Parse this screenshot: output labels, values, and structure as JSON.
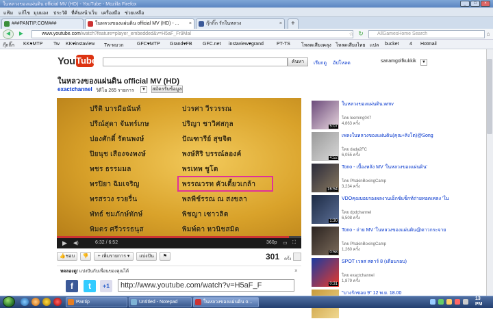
{
  "window": {
    "title": "ในหลวงของแผ่นดิน official MV (HD) - YouTube - Mozilla Firefox"
  },
  "menu": [
    "แฟ้ม",
    "แก้ไข",
    "มุมมอง",
    "ประวัติ",
    "ที่คั่นหน้าเว็บ",
    "เครื่องมือ",
    "ช่วยเหลือ"
  ],
  "tabs": [
    {
      "label": "###PANTIP.COM###",
      "fav": "#3a8f3a"
    },
    {
      "label": "ในหลวงของแผ่นดิน official MV (HD) - ...",
      "fav": "#c33"
    },
    {
      "label": "กุ๊กกิ๊ก รักในหลวง",
      "fav": "#3b5998"
    }
  ],
  "nav": {
    "url_host": "www.youtube.com",
    "url_path": "/watch?feature=player_embedded&v=H5aF_Fr9Mal",
    "search_placeholder": "AllGamesHome Search"
  },
  "bookmarks": [
    "กุ๊กกิ๊ก",
    "KK♥MTP",
    "Tw",
    "KK♥instaview",
    "Tw-หมวก",
    "GFC♥MTP",
    "Grand♥FB",
    "GFC.net",
    "instaview♥grand",
    "PT-TS",
    "โหลดเสียงคลุง",
    "โหลดเสียงไทย",
    "แปล",
    "bucket",
    "4",
    "Hotmail"
  ],
  "youtube": {
    "logo_you": "You",
    "logo_tube": "Tube",
    "search_btn": "ค้นหา",
    "links": [
      "เรียกดู",
      "อัปโหลด"
    ],
    "user": "sanamgolfkukkik"
  },
  "video": {
    "title": "ในหลวงของแผ่นดิน official MV (HD)",
    "channel": "exactchannel",
    "video_count": "วิดีโอ 265 รายการ",
    "subscribe": "สมัครรับข้อมูล",
    "credits_left": [
      "ปรีดิ บารมีอนันท์",
      "ปรีณ์สุดา จันทร์เกษ",
      "ปองศักดิ์ รัตนพงษ์",
      "ปิยนุช เสืองจงพงษ์",
      "พชร ธรรมมล",
      "พรปิยา ฉิมเจริญ",
      "พรสรวง รวยรื่น",
      "พัทธ์ ชมภักษ์ทักษ์",
      "พิมตร ศรีวรรธนุส"
    ],
    "credits_right": [
      "ปวรศา วีรวรรณ",
      "ปริญา ชาวิศสกุล",
      "ปัณฑารีย์ สุขจิต",
      "พงษ์สิริ บรรณ์ลองค์",
      "พรเทพ ชูโต",
      "พรรณวรท คัวเตี้ยวเกล้า",
      "พลพีช์รรณ ณ สงขลา",
      "พิชญา เซาวลิต",
      "พิมพ์ดา หวนิชสมิต"
    ],
    "time": "6:32 / 6:52",
    "quality": "360p",
    "progress": 0.95
  },
  "actions": {
    "like": "ชอบ",
    "add_to": "+ เพิ่มรายการ",
    "share": "แบ่งปัน",
    "views": "301",
    "views_unit": "ครั้ง"
  },
  "share": {
    "title": "ทดลองดู!",
    "text": " แบ่งปันกับเพื่อนของคุณได้",
    "url": "http://www.youtube.com/watch?v=H5aF_F"
  },
  "related": [
    {
      "title": "ในหลวงของแผ่นดิน.wmv",
      "user": "โดย leeming047",
      "views": "4,863 ครั้ง",
      "dur": "5:07",
      "c1": "#6b4a7a",
      "c2": "#e8d6de"
    },
    {
      "title": "เพลงในหลวงของแผ่นดิน(คุณ+สิงโต)@Song",
      "user": "โดย dada2FC",
      "views": "6,055 ครั้ง",
      "dur": "4:52",
      "c1": "#9a9a9a",
      "c2": "#d8d8d8"
    },
    {
      "title": "Tono - เบื้องหลัง MV 'ในหลวงของแผ่นดิน'",
      "user": "โดย PhakinBoxingCamp",
      "views": "3,234 ครั้ง",
      "dur": "16:54",
      "c1": "#2a2a3a",
      "c2": "#8a7a60"
    },
    {
      "title": "VDOคุณบอยรองผลงานเอ็กซ์แซ็กท์ถ่ายทอดเพลง 'ใน",
      "user": "โดย dpdchannel",
      "views": "6,508 ครั้ง",
      "dur": "1:30",
      "c1": "#1c2a44",
      "c2": "#5c6f96"
    },
    {
      "title": "Tono - ถ่าย MV 'ในหลวงของแผ่นดิน@ดาวกระจาย",
      "user": "โดย PhakinBoxingCamp",
      "views": "1,260 ครั้ง",
      "dur": "0:58",
      "c1": "#2b2320",
      "c2": "#7a6a5a"
    },
    {
      "title": "SPOT เวลส สตาร์ 8 (เดือนรอบ)",
      "user": "โดย exactchannel",
      "views": "1,879 ครั้ง",
      "dur": "0:31",
      "c1": "#1a3aa0",
      "c2": "#e83a2a"
    },
    {
      "title": "\"บางรักซอย 9\" 12 พ.ย. 18.00",
      "user": "",
      "views": "",
      "dur": "",
      "c1": "#c89a3a",
      "c2": "#f0d890"
    }
  ],
  "taskbar": {
    "items": [
      {
        "label": "Pantip",
        "color": "#e67e22"
      },
      {
        "label": "Untitled - Notepad",
        "color": "#7fb3d5"
      },
      {
        "label": "ในหลวงของแผ่นดิน o...",
        "color": "#c33"
      }
    ],
    "clock_time": "13",
    "clock_ampm": "PM"
  }
}
